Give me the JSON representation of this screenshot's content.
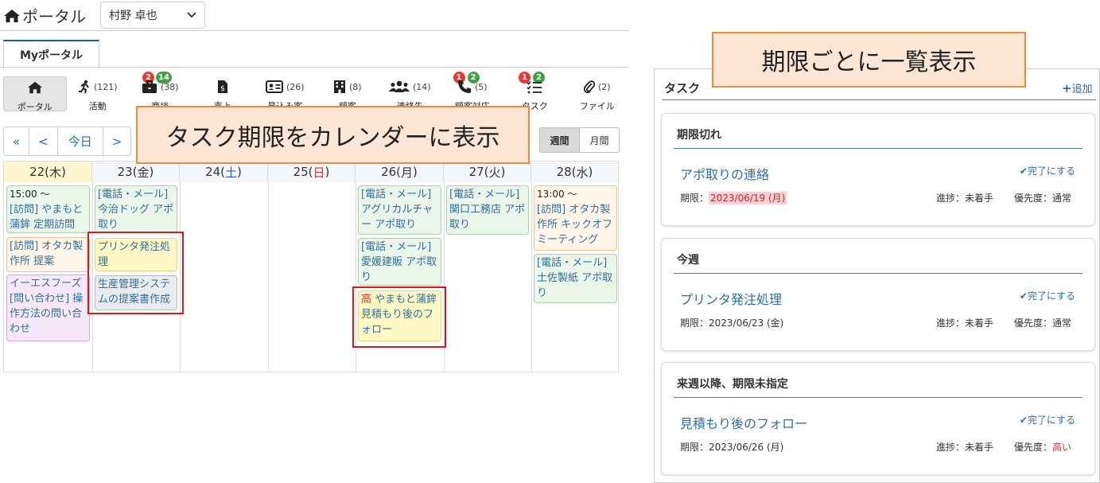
{
  "header": {
    "title": "ポータル",
    "user": "村野 卓也"
  },
  "tabs": {
    "my_portal": "Myポータル"
  },
  "modules": [
    {
      "label": "ポータル",
      "count": "",
      "icon": "home-icon"
    },
    {
      "label": "活動",
      "count": "(121)",
      "icon": "running-icon"
    },
    {
      "label": "商談",
      "count": "(38)",
      "icon": "briefcase-icon",
      "badge_red": "2",
      "badge_green": "14"
    },
    {
      "label": "売上",
      "count": "",
      "icon": "invoice-icon"
    },
    {
      "label": "見込み客",
      "count": "(26)",
      "icon": "id-card-icon"
    },
    {
      "label": "顧客",
      "count": "(8)",
      "icon": "building-icon"
    },
    {
      "label": "連絡先",
      "count": "(14)",
      "icon": "users-icon"
    },
    {
      "label": "顧客対応",
      "count": "(5)",
      "icon": "phone-icon",
      "badge_red": "1",
      "badge_green": "2"
    },
    {
      "label": "タスク",
      "count": "",
      "icon": "tasks-icon",
      "badge_red": "1",
      "badge_green": "2"
    },
    {
      "label": "ファイル",
      "count": "(2)",
      "icon": "paperclip-icon"
    }
  ],
  "nav": {
    "first": "«",
    "prev": "<",
    "today": "今日",
    "next": ">"
  },
  "view": {
    "week": "週間",
    "month": "月間"
  },
  "calendar": {
    "days": [
      {
        "num": "22",
        "wd": "木"
      },
      {
        "num": "23",
        "wd": "金"
      },
      {
        "num": "24",
        "wd": "土"
      },
      {
        "num": "25",
        "wd": "日"
      },
      {
        "num": "26",
        "wd": "月"
      },
      {
        "num": "27",
        "wd": "火"
      },
      {
        "num": "28",
        "wd": "水"
      }
    ],
    "events": {
      "d22_time": "15:00 ～",
      "d22_a": "[訪問] やまもと蒲鉾 定期訪問",
      "d22_b": "[訪問] オタカ製作所 提案",
      "d22_c": "イーエスフーズ [問い合わせ] 操作方法の問い合わせ",
      "d23_a": "[電話・メール] 今治ドッグ アポ取り",
      "d23_b": "プリンタ発注処理",
      "d23_c": "生産管理システムの提案書作成",
      "d26_a": "[電話・メール] アグリカルチャー アポ取り",
      "d26_b": "[電話・メール] 愛媛建販 アポ取り",
      "d26_c_pri": "高",
      "d26_c": " やまもと蒲鉾 見積もり後のフォロー",
      "d27_a": "[電話・メール] 関口工務店 アポ取り",
      "d28_time": "13:00 ～",
      "d28_a": "[訪問] オタカ製作所 キックオフミーティング",
      "d28_b": "[電話・メール] 土佐製紙 アポ取り"
    }
  },
  "callouts": {
    "calendar": "タスク期限をカレンダーに表示",
    "list": "期限ごとに一覧表示"
  },
  "tasks": {
    "title": "タスク",
    "add": "追加",
    "groups": [
      {
        "heading": "期限切れ",
        "name": "アポ取りの連絡",
        "done": "完了にする",
        "due_label": "期限：",
        "due": "2023/06/19 (月)",
        "progress": "進捗：未着手",
        "priority_label": "優先度：",
        "priority": "通常"
      },
      {
        "heading": "今週",
        "name": "プリンタ発注処理",
        "done": "完了にする",
        "due_label": "期限：",
        "due": "2023/06/23 (金)",
        "progress": "進捗：未着手",
        "priority_label": "優先度：",
        "priority": "通常"
      },
      {
        "heading": "来週以降、期限未指定",
        "name": "見積もり後のフォロー",
        "done": "完了にする",
        "due_label": "期限：",
        "due": "2023/06/26 (月)",
        "progress": "進捗：未着手",
        "priority_label": "優先度：",
        "priority": "高い"
      }
    ]
  },
  "colors": {
    "accent": "#2f6f9f",
    "saturday": "#1e5fb4",
    "sunday": "#d32f2f",
    "today_bg": "#fdf6cf",
    "highlight": "#e0161c"
  }
}
